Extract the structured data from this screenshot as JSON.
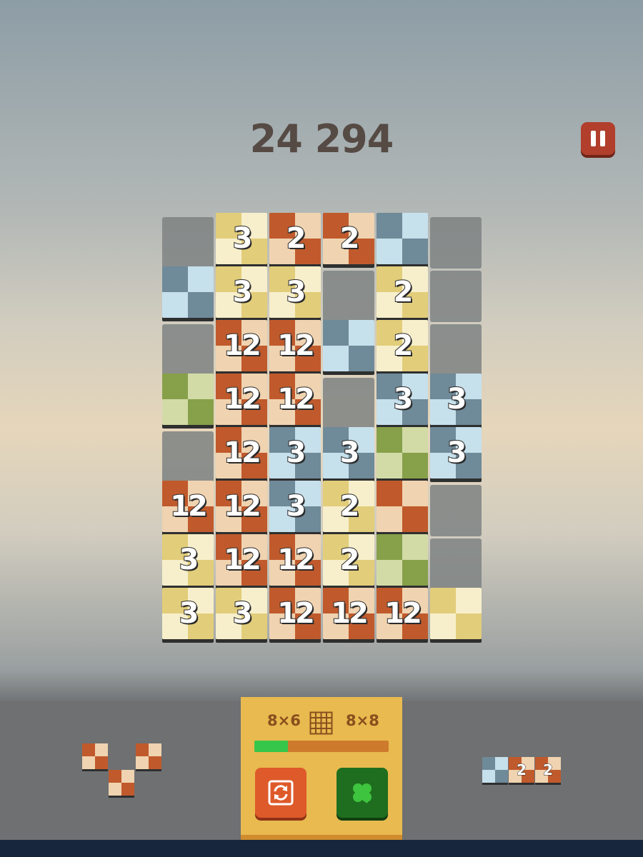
{
  "score": "24 294",
  "pause_icon": "pause-icon",
  "palettes": {
    "orange": [
      "#c05a2c",
      "#f0d3b0"
    ],
    "yellow": [
      "#e2cd7a",
      "#f7efcb"
    ],
    "blue": [
      "#6f8a99",
      "#c6e0ec"
    ],
    "green": [
      "#87a04a",
      "#d2dba6"
    ]
  },
  "board": {
    "rows": 8,
    "cols": 6,
    "tiles": [
      [
        "empty",
        "y:3",
        "o:2",
        "o:2",
        "b:",
        "empty"
      ],
      [
        "b:",
        "y:3",
        "y:3",
        "empty",
        "y:2",
        "empty"
      ],
      [
        "empty",
        "o:12",
        "o:12",
        "b:",
        "y:2",
        "empty"
      ],
      [
        "g:",
        "o:12",
        "o:12",
        "empty",
        "b:3",
        "b:3"
      ],
      [
        "empty",
        "o:12",
        "b:3",
        "b:3",
        "g:",
        "b:3"
      ],
      [
        "o:12",
        "o:12",
        "b:3",
        "y:2",
        "o:",
        "empty"
      ],
      [
        "y:3",
        "o:12",
        "o:12",
        "y:2",
        "g:",
        "empty"
      ],
      [
        "y:3",
        "y:3",
        "o:12",
        "o:12",
        "o:12",
        "y:"
      ]
    ]
  },
  "panel": {
    "left_size": "8×6",
    "right_size": "8×8",
    "grid_icon": "grid-icon",
    "progress": 0.25,
    "swap_icon": "swap-icon",
    "clover_icon": "clover-icon"
  },
  "next_pieces": {
    "left_piece": {
      "color": "orange",
      "icon": "checker-piece"
    },
    "right_piece": [
      {
        "color": "blue",
        "label": ""
      },
      {
        "color": "orange",
        "label": "2"
      },
      {
        "color": "orange",
        "label": "2"
      }
    ]
  }
}
